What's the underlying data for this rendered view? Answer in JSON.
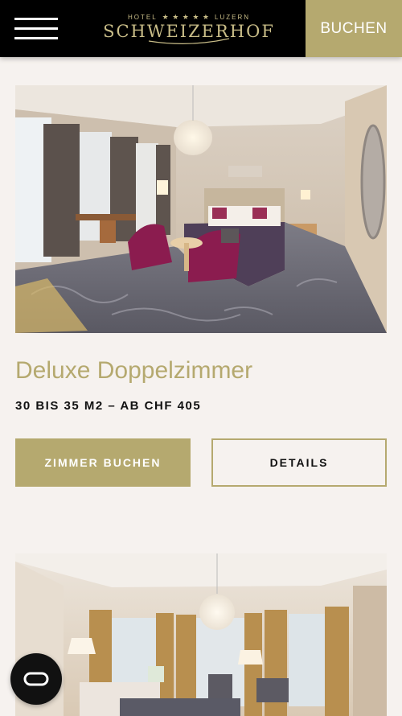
{
  "header": {
    "menu_icon": "hamburger-menu-icon",
    "logo": {
      "top_left": "HOTEL",
      "stars": "★ ★ ★ ★ ★",
      "top_right": "LUZERN",
      "name": "SCHWEIZERHOF"
    },
    "book_label": "BUCHEN"
  },
  "rooms": [
    {
      "title": "Deluxe Doppelzimmer",
      "subtitle": "30 BIS 35 M2 – AB CHF 405",
      "book_label": "ZIMMER BUCHEN",
      "details_label": "DETAILS"
    },
    {
      "image": "hotel-room-photo"
    }
  ],
  "chat": {
    "icon": "chat-loop-icon"
  },
  "colors": {
    "accent": "#b5a96f",
    "background": "#f6f2ef",
    "header": "#000000"
  }
}
